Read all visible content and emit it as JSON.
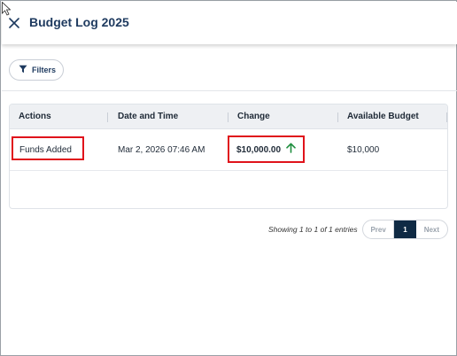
{
  "header": {
    "title": "Budget Log 2025"
  },
  "toolbar": {
    "filters_label": "Filters"
  },
  "table": {
    "columns": [
      "Actions",
      "Date and Time",
      "Change",
      "Available Budget"
    ],
    "rows": [
      {
        "action": "Funds Added",
        "date_time": "Mar 2, 2026 07:46 AM",
        "change": "$10,000.00",
        "change_direction": "up",
        "available_budget": "$10,000"
      }
    ]
  },
  "pagination": {
    "summary": "Showing 1 to 1 of 1 entries",
    "prev_label": "Prev",
    "current_page": "1",
    "next_label": "Next"
  },
  "colors": {
    "brand_navy": "#1e3a5f",
    "active_page": "#0f2a44",
    "up_arrow": "#1e8e3e",
    "highlight_box": "#e0131b"
  },
  "icons": [
    "close-icon",
    "filter-icon",
    "arrow-up-icon",
    "cursor-icon"
  ]
}
